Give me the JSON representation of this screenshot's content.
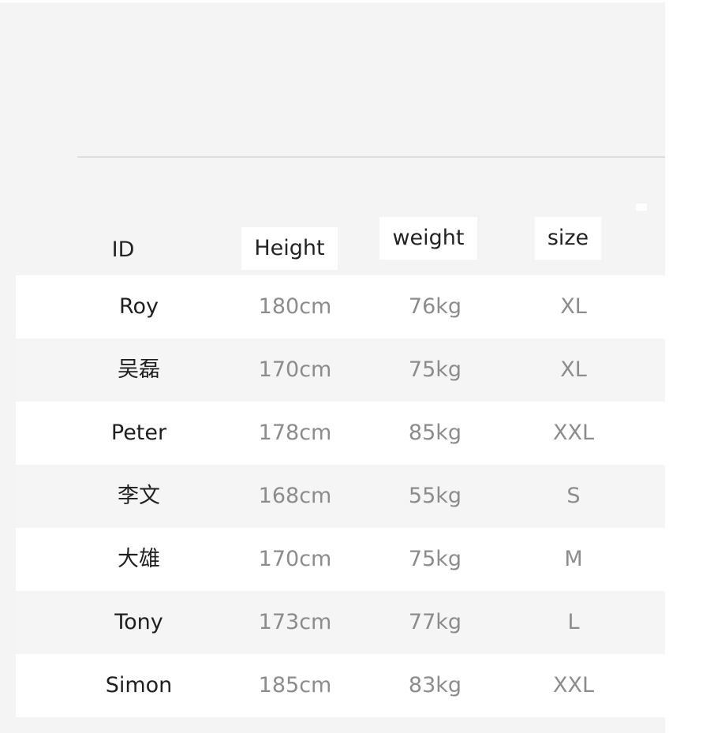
{
  "page": {
    "background_color": "#f4f4f5",
    "outside_color": "#ffffff"
  },
  "table": {
    "columns": [
      {
        "key": "id",
        "label": "ID",
        "highlighted": false
      },
      {
        "key": "height",
        "label": "Height",
        "highlighted": true
      },
      {
        "key": "weight",
        "label": "weight",
        "highlighted": true
      },
      {
        "key": "size",
        "label": "size",
        "highlighted": true
      }
    ],
    "rows": [
      {
        "id": "Roy",
        "height": "180cm",
        "weight": "76kg",
        "size": "XL"
      },
      {
        "id": "吴磊",
        "height": "170cm",
        "weight": "75kg",
        "size": "XL"
      },
      {
        "id": "Peter",
        "height": "178cm",
        "weight": "85kg",
        "size": "XXL"
      },
      {
        "id": "李文",
        "height": "168cm",
        "weight": "55kg",
        "size": "S"
      },
      {
        "id": "大雄",
        "height": "170cm",
        "weight": "75kg",
        "size": "M"
      },
      {
        "id": "Tony",
        "height": "173cm",
        "weight": "77kg",
        "size": "L"
      },
      {
        "id": "Simon",
        "height": "185cm",
        "weight": "83kg",
        "size": "XXL"
      }
    ],
    "colors": {
      "row_odd": "#ffffff",
      "row_even": "#f5f5f5",
      "id_text": "#1f1f1f",
      "value_text": "#8c8c8c",
      "header_text": "#232323",
      "header_highlight": "#ffffff",
      "divider": "#dddddd"
    }
  }
}
